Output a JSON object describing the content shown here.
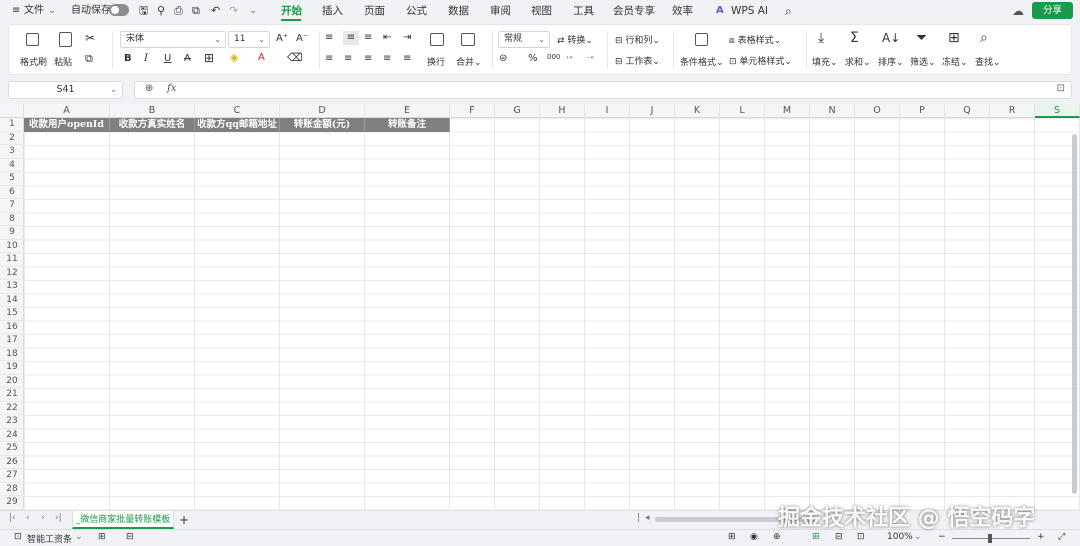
{
  "menubar": {
    "menu_icon": "≡",
    "file": "文件",
    "autosave_label": "自动保存",
    "tabs": [
      "开始",
      "插入",
      "页面",
      "公式",
      "数据",
      "审阅",
      "视图",
      "工具",
      "会员专享",
      "效率"
    ],
    "wps_ai": "WPS AI",
    "share": "分享"
  },
  "ribbon": {
    "format_painter": "格式刷",
    "paste": "粘贴",
    "font_name": "宋体",
    "font_size": "11",
    "bold": "B",
    "italic": "I",
    "underline": "U",
    "strike": "A",
    "wrap": "换行",
    "merge": "合并",
    "number_format": "常规",
    "convert": "转换",
    "rows_cols": "行和列",
    "worksheet": "工作表",
    "table_style": "表格样式",
    "cond_format": "条件格式",
    "cell_style": "单元格样式",
    "fill": "填充",
    "sum": "求和",
    "sort": "排序",
    "filter": "筛选",
    "freeze": "冻结",
    "find": "查找",
    "percent": "%",
    "thousands": "000"
  },
  "formula_bar": {
    "cell_ref": "S41",
    "fx": "fx",
    "value": ""
  },
  "columns": [
    "A",
    "B",
    "C",
    "D",
    "E",
    "F",
    "G",
    "H",
    "I",
    "J",
    "K",
    "L",
    "M",
    "N",
    "O",
    "P",
    "Q",
    "R",
    "S"
  ],
  "rows": [
    "1",
    "2",
    "3",
    "4",
    "5",
    "6",
    "7",
    "8",
    "9",
    "10",
    "11",
    "12",
    "13",
    "14",
    "15",
    "16",
    "17",
    "18",
    "19",
    "20",
    "21",
    "22",
    "23",
    "24",
    "25",
    "26",
    "27",
    "28",
    "29"
  ],
  "header_cells": [
    "收款用户openId",
    "收款方真实姓名",
    "收款方qq邮箱地址",
    "转账金额(元)",
    "转账备注"
  ],
  "sheet": {
    "tab_name": "_微信商家批量转账模板",
    "add": "+"
  },
  "status": {
    "payroll": "智能工资条",
    "zoom": "100%"
  },
  "watermark": "掘金技术社区 @ 悟空码字",
  "colors": {
    "accent": "#1a9a4c",
    "header_fill": "#808080"
  }
}
